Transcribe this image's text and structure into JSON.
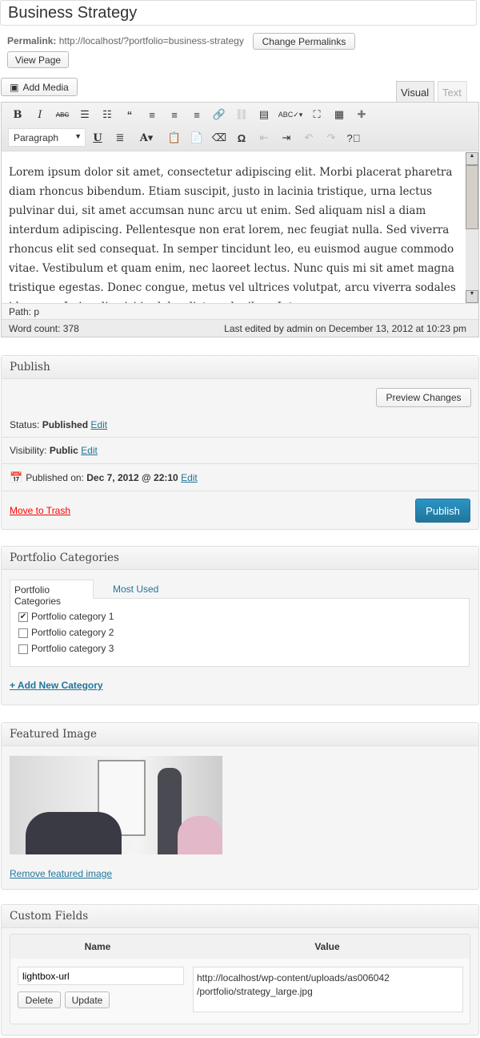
{
  "title": "Business Strategy",
  "permalink": {
    "label": "Permalink:",
    "url": "http://localhost/?portfolio=business-strategy",
    "change_btn": "Change Permalinks",
    "view_btn": "View Page"
  },
  "editor": {
    "add_media": "Add Media",
    "tab_visual": "Visual",
    "tab_text": "Text",
    "format_select": "Paragraph",
    "content": "Lorem ipsum dolor sit amet, consectetur adipiscing elit. Morbi placerat pharetra diam rhoncus bibendum. Etiam suscipit, justo in lacinia tristique, urna lectus pulvinar dui, sit amet accumsan nunc arcu ut enim. Sed aliquam nisl a diam interdum adipiscing. Pellentesque non erat lorem, nec feugiat nulla. Sed viverra rhoncus elit sed consequat. In semper tincidunt leo, eu euismod augue commodo vitae. Vestibulum et quam enim, nec laoreet lectus. Nunc quis mi sit amet magna tristique egestas. Donec congue, metus vel ultrices volutpat, arcu viverra sodales id a arcu. In iaculis nisi in dolor dictum dapibus. Integer posuere",
    "path": "Path: p",
    "word_count": "Word count: 378",
    "last_edited": "Last edited by admin on December 13, 2012 at 10:23 pm"
  },
  "publish": {
    "title": "Publish",
    "preview_btn": "Preview Changes",
    "status_label": "Status:",
    "status": "Published",
    "visibility_label": "Visibility:",
    "visibility": "Public",
    "published_label": "Published on:",
    "published": "Dec 7, 2012 @ 22:10",
    "edit": "Edit",
    "trash": "Move to Trash",
    "publish_btn": "Publish"
  },
  "categories": {
    "title": "Portfolio Categories",
    "tab_all": "Portfolio Categories",
    "tab_most": "Most Used",
    "items": [
      {
        "label": "Portfolio category 1",
        "checked": true
      },
      {
        "label": "Portfolio category 2",
        "checked": false
      },
      {
        "label": "Portfolio category 3",
        "checked": false
      }
    ],
    "add_new": "+ Add New Category"
  },
  "featured": {
    "title": "Featured Image",
    "remove": "Remove featured image"
  },
  "custom": {
    "title": "Custom Fields",
    "col_name": "Name",
    "col_value": "Value",
    "name": "lightbox-url",
    "value": "http://localhost/wp-content/uploads/as006042\n/portfolio/strategy_large.jpg",
    "delete_btn": "Delete",
    "update_btn": "Update"
  },
  "colors": {
    "link": "#21759b",
    "publish_btn": "#2a8bbd",
    "trash": "#ff0000"
  }
}
